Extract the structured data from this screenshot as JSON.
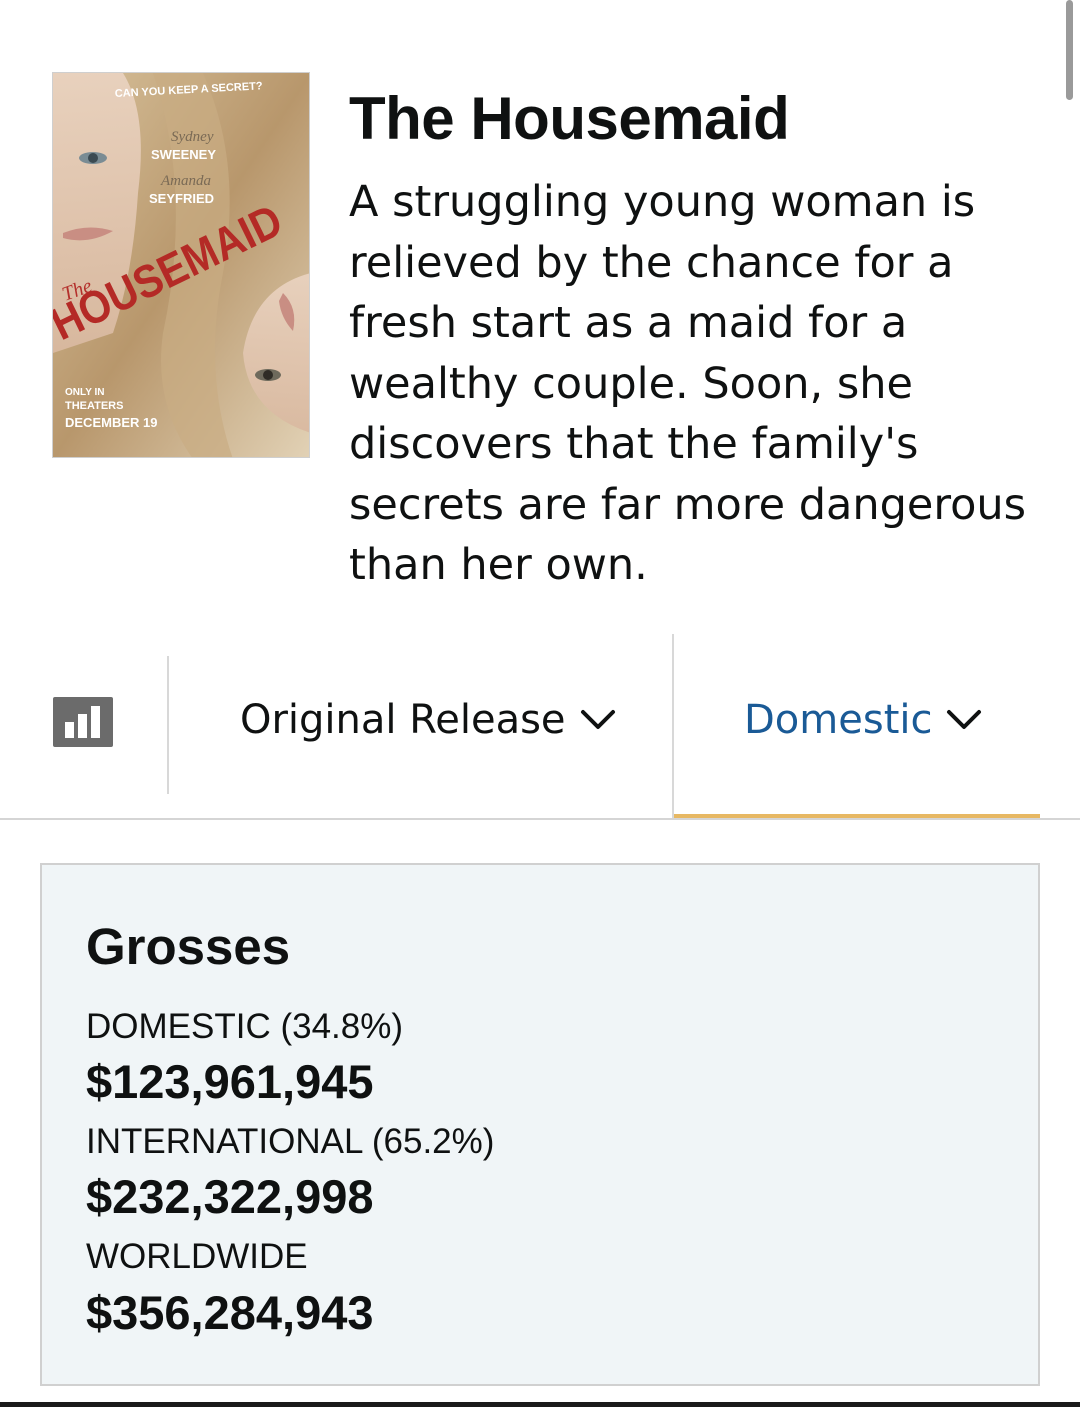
{
  "movie": {
    "title": "The Housemaid",
    "synopsis": "A struggling young woman is relieved by the chance for a fresh start as a maid for a wealthy couple. Soon, she discovers that the family's secrets are far more dangerous than her own."
  },
  "poster": {
    "tagline": "CAN YOU KEEP A SECRET?",
    "actor1_first": "Sydney",
    "actor1_last": "SWEENEY",
    "actor2_first": "Amanda",
    "actor2_last": "SEYFRIED",
    "title_small": "The",
    "title_big": "HOUSEMAID",
    "release_line1": "ONLY IN",
    "release_line2": "THEATERS",
    "release_line3": "DECEMBER 19"
  },
  "filters": {
    "chart_icon": "bar-chart-icon",
    "release_label": "Original Release",
    "region_label": "Domestic",
    "chevron_icon": "chevron-down-icon",
    "active_color": "#e7b863",
    "link_color": "#1a5a96"
  },
  "grosses": {
    "title": "Grosses",
    "domestic_label": "DOMESTIC (34.8%)",
    "domestic_value": "$123,961,945",
    "international_label": "INTERNATIONAL (65.2%)",
    "international_value": "$232,322,998",
    "worldwide_label": "WORLDWIDE",
    "worldwide_value": "$356,284,943"
  }
}
